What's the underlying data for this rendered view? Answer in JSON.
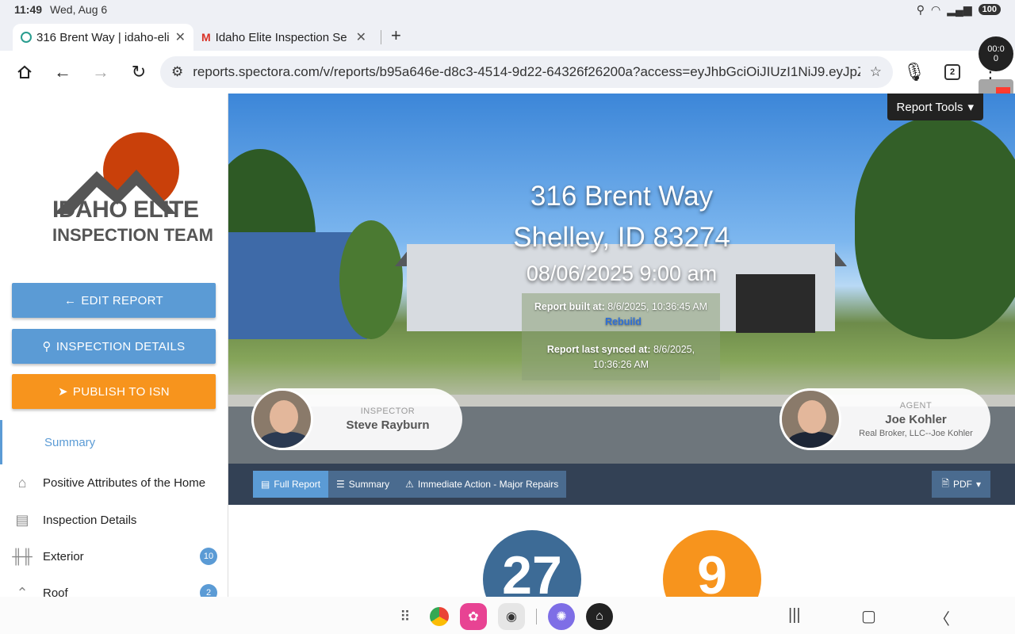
{
  "status_bar": {
    "time": "11:49",
    "date": "Wed, Aug 6",
    "battery": "100"
  },
  "tabs": [
    {
      "title": "316 Brent Way | idaho-eli",
      "icon": "spectora-favicon"
    },
    {
      "title": "Idaho Elite Inspection Se",
      "icon": "gmail-favicon"
    }
  ],
  "toolbar": {
    "url": "reports.spectora.com/v/reports/b95a646e-d8c3-4514-9d22-64326f26200a?access=eyJhbGciOiJIUzI1NiJ9.eyJpZ",
    "tab_count": "2"
  },
  "recorder": {
    "timer": "00:0\n0"
  },
  "sidebar": {
    "logo_line1": "IDAHO ELITE",
    "logo_line2": "INSPECTION TEAM",
    "edit_report": "EDIT REPORT",
    "inspection_details_btn": "INSPECTION DETAILS",
    "publish": "PUBLISH TO ISN",
    "summary": "Summary",
    "items": [
      {
        "label": "Positive Attributes of the Home",
        "icon": "house-icon",
        "badge": ""
      },
      {
        "label": "Inspection Details",
        "icon": "document-icon",
        "badge": ""
      },
      {
        "label": "Exterior",
        "icon": "fence-icon",
        "badge": "10"
      },
      {
        "label": "Roof",
        "icon": "roof-icon",
        "badge": "2"
      }
    ]
  },
  "hero": {
    "address1": "316 Brent Way",
    "address2": "Shelley, ID 83274",
    "datetime": "08/06/2025 9:00 am",
    "built_label": "Report built at:",
    "built_value": "8/6/2025, 10:36:45 AM",
    "rebuild": "Rebuild",
    "synced_label": "Report last synced at:",
    "synced_value": "8/6/2025, 10:36:26 AM",
    "report_tools": "Report Tools"
  },
  "inspector": {
    "role": "INSPECTOR",
    "name": "Steve Rayburn"
  },
  "agent": {
    "role": "AGENT",
    "name": "Joe Kohler",
    "company": "Real Broker, LLC--Joe Kohler"
  },
  "report_tabs": [
    "Full Report",
    "Summary",
    "Immediate Action - Major Repairs"
  ],
  "pdf_label": "PDF",
  "counts": {
    "blue": "27",
    "orange": "9"
  },
  "colors": {
    "accent_blue": "#5b9bd5",
    "accent_orange": "#f7941d",
    "navbar": "#334155"
  }
}
